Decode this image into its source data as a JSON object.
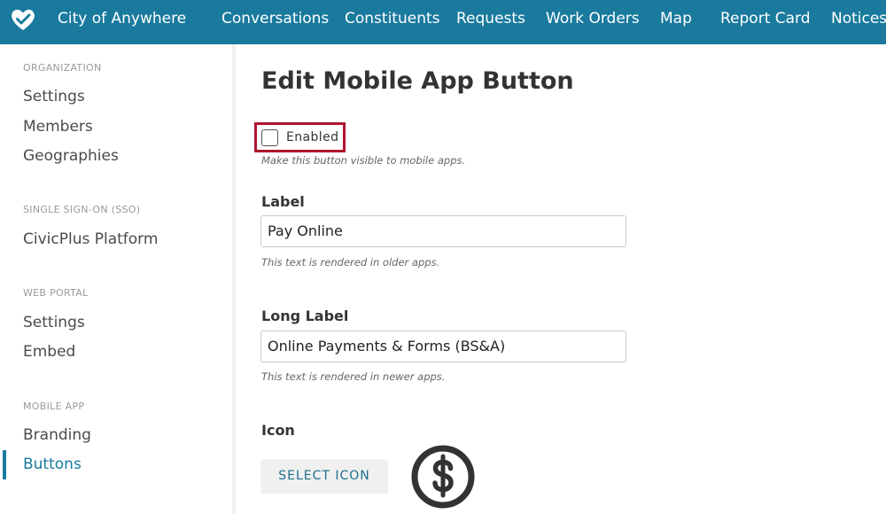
{
  "header": {
    "app_title": "City of Anywhere",
    "logo_icon": "heart-check-icon",
    "nav": [
      "Conversations",
      "Constituents",
      "Requests",
      "Work Orders",
      "Map",
      "Report Card",
      "Notices"
    ]
  },
  "sidebar": {
    "organization": {
      "heading": "ORGANIZATION",
      "items": [
        "Settings",
        "Members",
        "Geographies"
      ]
    },
    "sso": {
      "heading": "SINGLE SIGN-ON (SSO)",
      "items": [
        "CivicPlus Platform"
      ]
    },
    "web_portal": {
      "heading": "WEB PORTAL",
      "items": [
        "Settings",
        "Embed"
      ]
    },
    "mobile_app": {
      "heading": "MOBILE APP",
      "items": [
        "Branding",
        "Buttons"
      ],
      "active": "Buttons"
    }
  },
  "main": {
    "title": "Edit Mobile App Button",
    "enabled": {
      "label": "Enabled",
      "checked": false,
      "help": "Make this button visible to mobile apps."
    },
    "label_field": {
      "label": "Label",
      "value": "Pay Online",
      "help": "This text is rendered in older apps."
    },
    "long_label_field": {
      "label": "Long Label",
      "value": "Online Payments & Forms (BS&A)",
      "help": "This text is rendered in newer apps."
    },
    "icon": {
      "label": "Icon",
      "button": "SELECT ICON",
      "preview_icon": "dollar-circle-icon"
    }
  },
  "colors": {
    "brand": "#1a7a9e",
    "highlight": "#b0142f"
  }
}
